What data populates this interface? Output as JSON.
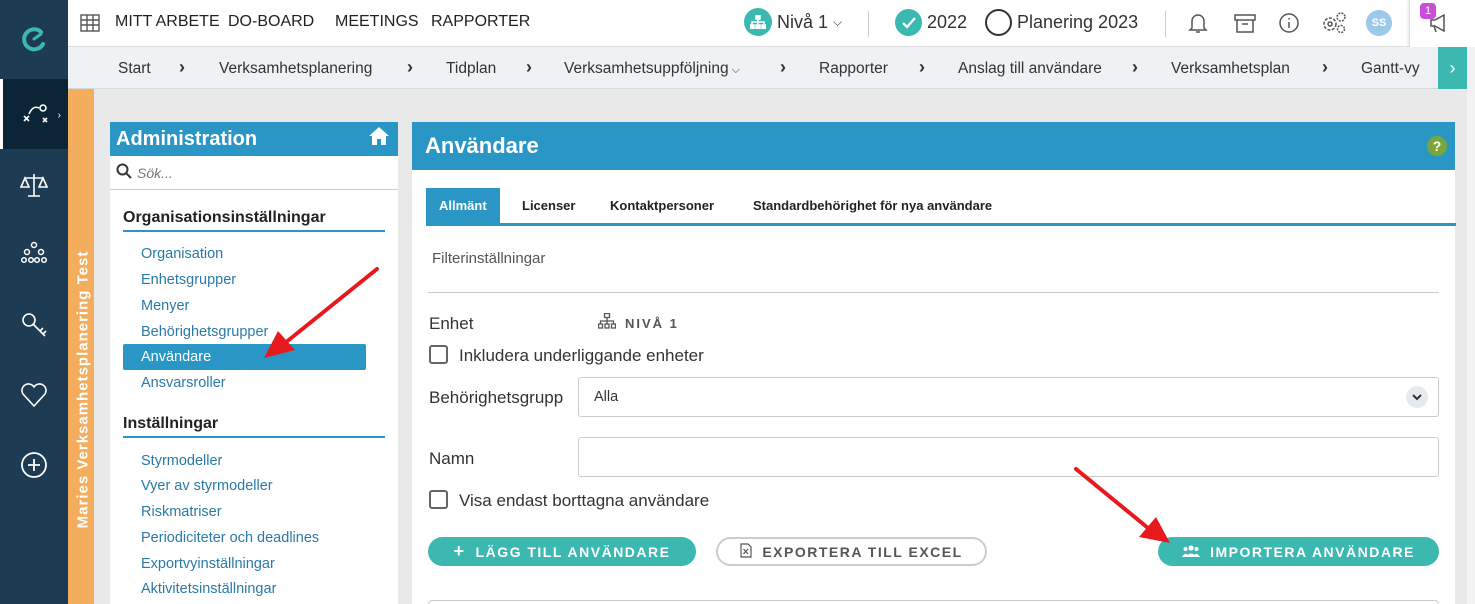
{
  "topnav": {
    "items": [
      "MITT ARBETE",
      "DO-BOARD",
      "MEETINGS",
      "RAPPORTER"
    ],
    "level_label": "Nivå 1",
    "year_label": "2022",
    "planning_label": "Planering 2023",
    "avatar_initials": "SS",
    "notification_count": "1"
  },
  "breadcrumbs": [
    "Start",
    "Verksamhetsplanering",
    "Tidplan",
    "Verksamhetsuppföljning",
    "Rapporter",
    "Anslag till användare",
    "Verksamhetsplan",
    "Gantt-vy"
  ],
  "side_banner": "Maries Verksamhetsplanering Test",
  "admin": {
    "title": "Administration",
    "search_placeholder": "Sök...",
    "section1": "Organisationsinställningar",
    "section1_items": [
      "Organisation",
      "Enhetsgrupper",
      "Menyer",
      "Behörighetsgrupper",
      "Användare",
      "Ansvarsroller"
    ],
    "section2": "Inställningar",
    "section2_items": [
      "Styrmodeller",
      "Vyer av styrmodeller",
      "Riskmatriser",
      "Periodiciteter och deadlines",
      "Exportvyinställningar",
      "Aktivitetsinställningar"
    ]
  },
  "main": {
    "title": "Användare",
    "help": "?",
    "tabs": [
      "Allmänt",
      "Licenser",
      "Kontaktpersoner",
      "Standardbehörighet för nya användare"
    ],
    "filter_heading": "Filterinställningar",
    "unit_label": "Enhet",
    "unit_value": "NIVÅ 1",
    "include_sub_label": "Inkludera underliggande enheter",
    "group_label": "Behörighetsgrupp",
    "group_value": "Alla",
    "name_label": "Namn",
    "name_value": "",
    "deleted_only_label": "Visa endast borttagna användare",
    "add_button": "LÄGG TILL ANVÄNDARE",
    "export_button": "EXPORTERA TILL EXCEL",
    "import_button": "IMPORTERA ANVÄNDARE"
  },
  "colors": {
    "rail": "#1d3b52",
    "primary_blue": "#2a96c6",
    "teal": "#3bb8b0",
    "orange_banner": "#f3ad5c",
    "annotation_arrow": "#e8191c"
  }
}
